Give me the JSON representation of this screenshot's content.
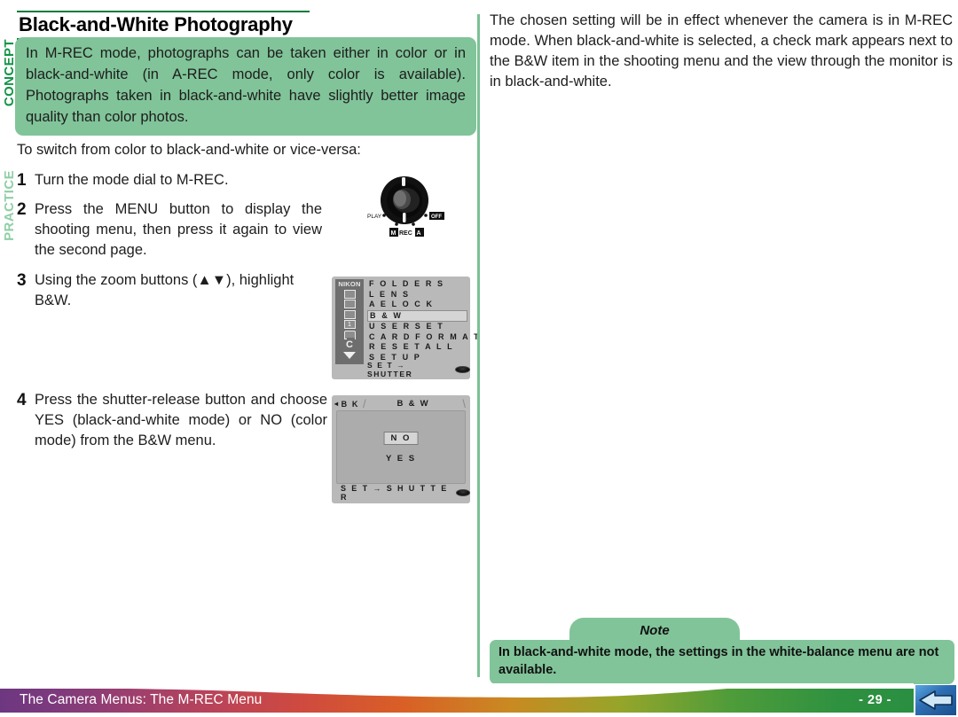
{
  "page": {
    "title": "Black-and-White Photography",
    "page_number": "- 29 -",
    "footer_label": "The Camera Menus: The M-REC Menu"
  },
  "sidebar_tabs": {
    "concept": "CONCEPT",
    "practice": "PRACTICE"
  },
  "concept": {
    "text": "In M-REC mode, photographs can be taken either in color or in black-and-white (in A-REC mode, only color is available).  Photographs taken in black-and-white have slightly better image quality than color photos."
  },
  "intro": {
    "text": "To switch from color to black-and-white or vice-versa:"
  },
  "steps": [
    {
      "num": "1",
      "text": "Turn the mode dial to M-REC."
    },
    {
      "num": "2",
      "text": "Press the MENU button to display the shooting menu, then press it again to view the second page."
    },
    {
      "num": "3",
      "text": "Using the zoom buttons (▲▼), highlight B&W."
    },
    {
      "num": "4",
      "text": "Press the shutter-release button and choose YES (black-and-white mode) or NO (color mode) from the B&W menu."
    }
  ],
  "mode_dial": {
    "label_play": "PLAY",
    "label_off": "OFF",
    "label_m": "M",
    "label_rec": "REC",
    "label_a": "A"
  },
  "lcd_shooting_menu": {
    "brand": "NIKON",
    "items": [
      "F O L D E R S",
      "L E N S",
      "A E   L O C K",
      "B & W",
      "U S E R   S E T",
      "C A R D F O R M A T",
      "R E S E T   A L L",
      "S E T   U P"
    ],
    "selected_index": 3,
    "sidebar_icons": [
      "square",
      "square",
      "square",
      "1",
      "card",
      "C",
      "down-arrow"
    ],
    "sidebar_card_label": "CARD",
    "sidebar_c_label": "C",
    "sidebar_one_label": "1",
    "footer": "S E T → SHUTTER"
  },
  "lcd_bw_menu": {
    "back_label": "B K",
    "title": "B & W",
    "options": [
      "N O",
      "Y E S"
    ],
    "selected_option": "N O",
    "footer": "S E T → S H U T T E R"
  },
  "right_column": {
    "paragraph": "The chosen setting will be in effect whenever the camera is in M-REC mode.  When black-and-white is selected, a check mark appears next to the B&W item in the shooting menu and the view through the monitor is in black-and-white."
  },
  "note": {
    "heading": "Note",
    "text": "In black-and-white mode, the settings in the white-balance menu are not available."
  },
  "colors": {
    "green_box": "#81c499",
    "concept_green": "#149447",
    "practice_green": "#8fcfa6",
    "rule_green": "#0a7a3c",
    "divider_green": "#7cc094",
    "footer_start": "#6d3780",
    "footer_end": "#2a8f41",
    "next_button_blue": "#2f6fb5"
  }
}
